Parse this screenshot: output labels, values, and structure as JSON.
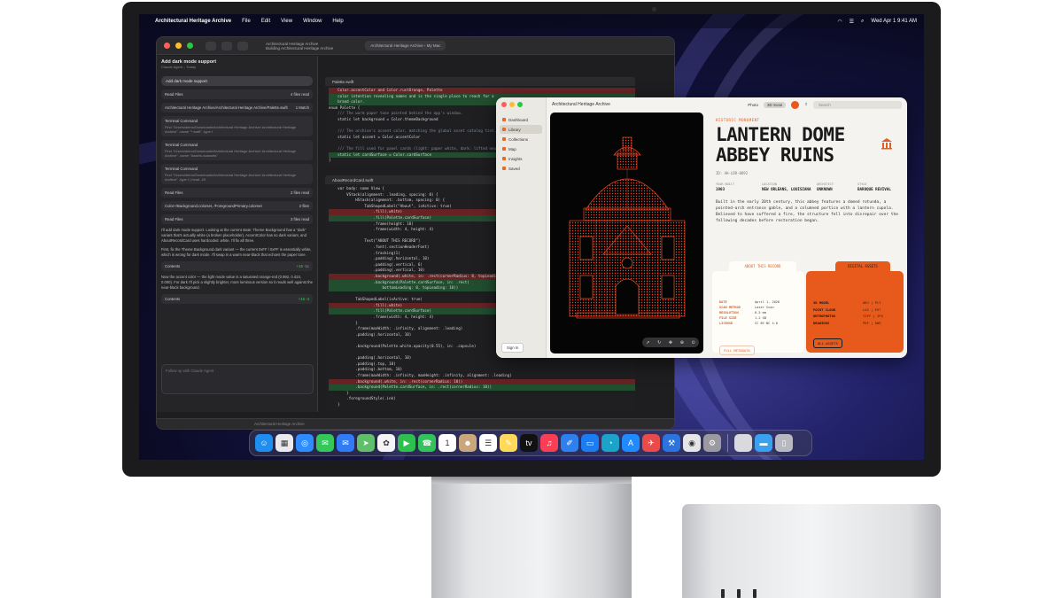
{
  "menubar": {
    "app_name": "Architectural Heritage Archive",
    "items": [
      "File",
      "Edit",
      "View",
      "Window",
      "Help"
    ],
    "clock": "Wed Apr 1  9:41 AM"
  },
  "xcode": {
    "window_title": "Architectural Heritage Archive",
    "window_subtitle": "Building Architectural Heritage Archive",
    "scheme": "Architectural Heritage Archive",
    "device": "My Mac",
    "chat": {
      "title": "Add dark mode support",
      "subtitle": "Claude Agent – Today",
      "user_message": "Add dark mode support.",
      "cards": [
        {
          "title": "Read Files",
          "meta": "4 files read",
          "body": ""
        },
        {
          "title": "Architectural Heritage Archive/Architectural Heritage Archive/Palette.swift",
          "meta": "1 Match",
          "body": ""
        },
        {
          "title": "Terminal Command",
          "meta": "",
          "body": "Find \"/Users/demo/Downloads/Architectural Heritage Archive/ Architectural Heritage Archive\" -name \"*.swift\" -type f"
        },
        {
          "title": "Terminal Command",
          "meta": "",
          "body": "Find \"/Users/demo/Downloads/Architectural Heritage Archive/ Architectural Heritage Archive\" -name \"Assets.xcassets\""
        },
        {
          "title": "Terminal Command",
          "meta": "",
          "body": "Find \"/Users/demo/Downloads/Architectural Heritage Archive/ Architectural Heritage Archive\" -type f | head -20"
        },
        {
          "title": "Read Files",
          "meta": "2 files read",
          "body": ""
        },
        {
          "title": "Color+/Background.colorset, /ForegroundPrimary.colorset",
          "meta": "2 files",
          "body": ""
        },
        {
          "title": "Read Files",
          "meta": "3 files read",
          "body": ""
        }
      ],
      "para1": "I'll add dark mode support. Looking at the current state: Theme Background has a \"dark\" variant that's actually white (a broken placeholder), AccentColor has no dark variant, and AboutRecordCard uses hardcoded .white. I'll fix all three.",
      "para2": "First, fix the Theme Background dark variant — the current 0xFF / 0xFF is essentially white, which is wrong for dark mode. I'll swap in a warm near-black that echoes the paper tone.",
      "diff1_label": "Contents",
      "diff1_stat": "+19 -11",
      "para3": "Now the accent color — the light mode value is a saturated orange-red (0.992, 0.424, 0.000). For dark I'll pick a slightly brighter, more luminous version so it reads well against the near-black background.",
      "diff2_label": "Contents",
      "diff2_stat": "+15 -4",
      "input_placeholder": "Follow up with Claude Agent"
    },
    "status": "Architectural Heritage Archive",
    "editor1": {
      "filename": "Palette.swift",
      "lines": [
        {
          "t": "    Color.accentColor and Color.rustOrange, Palette ",
          "c": "del"
        },
        {
          "t": "    color intention revealing names and is the single place to reach for a",
          "c": "add"
        },
        {
          "t": "    brand color.",
          "c": "add"
        },
        {
          "t": "enum Palette {",
          "c": ""
        },
        {
          "t": "    /// The warm paper tone painted behind the app's window.",
          "c": "cm"
        },
        {
          "t": "    static let background = Color.themeBackground",
          "c": ""
        },
        {
          "t": "",
          "c": ""
        },
        {
          "t": "    /// The archive's accent color, matching the global asset catalog tint.",
          "c": "cm"
        },
        {
          "t": "    static let accent = Color.accentColor",
          "c": ""
        },
        {
          "t": "",
          "c": ""
        },
        {
          "t": "    /// The fill used for panel cards (light: paper white, dark: lifted neutral).",
          "c": "cm"
        },
        {
          "t": "    static let cardSurface = Color.cardSurface",
          "c": "add"
        },
        {
          "t": "}",
          "c": ""
        }
      ]
    },
    "editor2": {
      "filename": "AboutRecordCard.swift",
      "lines": [
        {
          "t": "    var body: some View {",
          "c": ""
        },
        {
          "t": "        VStack(alignment: .leading, spacing: 0) {",
          "c": ""
        },
        {
          "t": "            HStack(alignment: .bottom, spacing: 0) {",
          "c": ""
        },
        {
          "t": "                TabShapedLabel(\"About\", isActive: true)",
          "c": ""
        },
        {
          "t": "                    .fill(.white)",
          "c": "del"
        },
        {
          "t": "                    .fill(Palette.cardSurface)",
          "c": "add"
        },
        {
          "t": "                    .frame(height: 18)",
          "c": ""
        },
        {
          "t": "                    .frame(width: 4, height: 4)",
          "c": ""
        },
        {
          "t": "",
          "c": ""
        },
        {
          "t": "                Text(\"ABOUT THIS RECORD\")",
          "c": ""
        },
        {
          "t": "                    .font(.sectionHeaderFont)",
          "c": ""
        },
        {
          "t": "                    .tracking(1)",
          "c": ""
        },
        {
          "t": "                    .padding(.horizontal, 10)",
          "c": ""
        },
        {
          "t": "                    .padding(.vertical, 6)",
          "c": ""
        },
        {
          "t": "                    .padding(.vertical, 10)",
          "c": ""
        },
        {
          "t": "                    .background(.white, in: .rect(cornerRadius: 8, topLeading: 10))",
          "c": "del"
        },
        {
          "t": "                    .background(Palette.cardSurface, in: .rect(",
          "c": "add"
        },
        {
          "t": "                        bottomLeading: 0, topLeading: 10))",
          "c": "add"
        },
        {
          "t": "",
          "c": ""
        },
        {
          "t": "            TabShapedLabel(isActive: true)",
          "c": ""
        },
        {
          "t": "                    .fill(.white)",
          "c": "del"
        },
        {
          "t": "                    .fill(Palette.cardSurface)",
          "c": "add"
        },
        {
          "t": "                    .frame(width: 4, height: 4)",
          "c": ""
        },
        {
          "t": "            }",
          "c": ""
        },
        {
          "t": "            .frame(maxWidth: .infinity, alignment: .leading)",
          "c": ""
        },
        {
          "t": "            .padding(.horizontal, 10)",
          "c": ""
        },
        {
          "t": "",
          "c": ""
        },
        {
          "t": "            .background(Palette.white.opacity(0.55), in: .capsule)",
          "c": ""
        },
        {
          "t": "",
          "c": ""
        },
        {
          "t": "            .padding(.horizontal, 10)",
          "c": ""
        },
        {
          "t": "            .padding(.top, 10)",
          "c": ""
        },
        {
          "t": "            .padding(.bottom, 10)",
          "c": ""
        },
        {
          "t": "            .frame(maxWidth: .infinity, maxHeight: .infinity, alignment: .leading)",
          "c": ""
        },
        {
          "t": "            .background(.white, in: .rect(cornerRadius: 10))",
          "c": "del"
        },
        {
          "t": "            .background(Palette.cardSurface, in: .rect(cornerRadius: 10))",
          "c": "add"
        },
        {
          "t": "        }",
          "c": ""
        },
        {
          "t": "        .foregroundStyle(.ink)",
          "c": ""
        },
        {
          "t": "    }",
          "c": ""
        }
      ]
    }
  },
  "archive": {
    "window_title": "Architectural Heritage Archive",
    "toolbar": {
      "photo": "Photo",
      "scan": "3D Scan",
      "search_placeholder": "Search"
    },
    "sidebar": [
      "Dashboard",
      "Library",
      "Collections",
      "Map",
      "Insights",
      "Saved"
    ],
    "sign_in": "Sign In",
    "kicker": "HISTORIC MONUMENT",
    "title_line1": "LANTERN DOME",
    "title_line2": "ABBEY RUINS",
    "record_id": "ID: AH-LDR-0892",
    "meta": [
      {
        "k": "YEAR BUILT",
        "v": "1903"
      },
      {
        "k": "LOCATION",
        "v": "NEW ORLEANS, LOUISIANA"
      },
      {
        "k": "ARCHITECT",
        "v": "UNKNOWN"
      },
      {
        "k": "STYLE",
        "v": "BAROQUE REVIVAL"
      }
    ],
    "description": "Built in the early 20th century, this abbey features a domed rotunda, a pointed-arch entrance gable, and a columned portico with a lantern cupola. Believed to have suffered a fire, the structure fell into disrepair over the following decades before restoration began.",
    "tab_about": "ABOUT THIS RECORD",
    "tab_digital": "DIGITAL ASSETS",
    "about_rows": [
      {
        "k": "DATE",
        "v": "April 1, 2026"
      },
      {
        "k": "SCAN METHOD",
        "v": "Laser Scan"
      },
      {
        "k": "RESOLUTION",
        "v": "0.5 mm"
      },
      {
        "k": "FILE SIZE",
        "v": "1.2 GB"
      },
      {
        "k": "LICENSE",
        "v": "CC BY-NC 4.0"
      }
    ],
    "full_metadata": "FULL METADATA",
    "digital_rows": [
      {
        "k": "3D MODEL",
        "v": "OBJ | PLY"
      },
      {
        "k": "POINT CLOUD",
        "v": "LAS | E57"
      },
      {
        "k": "ORTHOPHOTOS",
        "v": "TIFF | JPG"
      },
      {
        "k": "DRAWINGS",
        "v": "PDF | DWG"
      }
    ],
    "all_assets": "ALL ASSETS"
  },
  "dock": [
    {
      "name": "finder-icon",
      "color": "#1e8ef0",
      "g": "☺"
    },
    {
      "name": "launchpad-icon",
      "color": "#e9e9ee",
      "g": "▦"
    },
    {
      "name": "safari-icon",
      "color": "#2d8cff",
      "g": "◎"
    },
    {
      "name": "messages-icon",
      "color": "#34c759",
      "g": "✉"
    },
    {
      "name": "mail-icon",
      "color": "#2f7cf6",
      "g": "✉"
    },
    {
      "name": "maps-icon",
      "color": "#5fbf6a",
      "g": "➤"
    },
    {
      "name": "photos-icon",
      "color": "#f4f4f6",
      "g": "✿"
    },
    {
      "name": "facetime-icon",
      "color": "#2fbf4f",
      "g": "▶"
    },
    {
      "name": "phone-icon",
      "color": "#32c35a",
      "g": "☎"
    },
    {
      "name": "calendar-icon",
      "color": "#ffffff",
      "g": "1"
    },
    {
      "name": "contacts-icon",
      "color": "#c9a77a",
      "g": "☻"
    },
    {
      "name": "reminders-icon",
      "color": "#ffffff",
      "g": "☰"
    },
    {
      "name": "notes-icon",
      "color": "#ffd95a",
      "g": "✎"
    },
    {
      "name": "tv-icon",
      "color": "#111111",
      "g": "tv"
    },
    {
      "name": "music-icon",
      "color": "#fa3e55",
      "g": "♫"
    },
    {
      "name": "freeform-icon",
      "color": "#2f80ed",
      "g": "✐"
    },
    {
      "name": "keynote-icon",
      "color": "#1c7cf2",
      "g": "▭"
    },
    {
      "name": "instruments-icon",
      "color": "#1ba3c9",
      "g": "◔"
    },
    {
      "name": "app-store-icon",
      "color": "#1f8bff",
      "g": "A"
    },
    {
      "name": "testflight-icon",
      "color": "#e94b4b",
      "g": "✈"
    },
    {
      "name": "xcode-icon",
      "color": "#2b74e0",
      "g": "⚒"
    },
    {
      "name": "claude-icon",
      "color": "#e5e5e7",
      "g": "◉"
    },
    {
      "name": "settings-icon",
      "color": "#9a9aa0",
      "g": "⚙"
    }
  ],
  "dock_right": [
    {
      "name": "archive-app-icon",
      "color": "#d9d9de",
      "g": ""
    },
    {
      "name": "folder-icon",
      "color": "#3aa0f0",
      "g": "▬"
    },
    {
      "name": "trash-icon",
      "color": "#b8b8c0",
      "g": "▯"
    }
  ]
}
